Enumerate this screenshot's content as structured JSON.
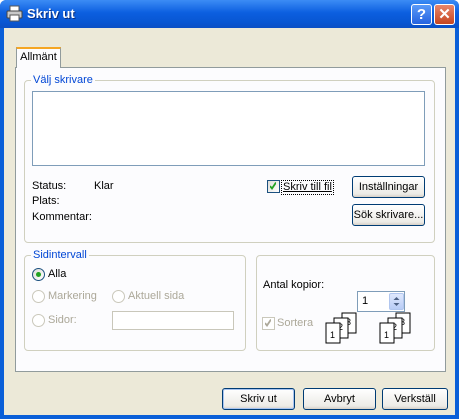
{
  "window": {
    "title": "Skriv ut",
    "help_label": "?",
    "close_label": "✕"
  },
  "tabs": [
    {
      "label": "Allmänt"
    }
  ],
  "printer_group": {
    "label": "Välj skrivare",
    "status_label": "Status:",
    "status_value": "Klar",
    "location_label": "Plats:",
    "comment_label": "Kommentar:",
    "print_to_file_label": "Skriv till fil",
    "print_to_file_checked": true,
    "preferences_button": "Inställningar",
    "find_printer_button": "Sök skrivare..."
  },
  "page_range": {
    "label": "Sidintervall",
    "all_label": "Alla",
    "selection_label": "Markering",
    "current_page_label": "Aktuell sida",
    "pages_label": "Sidor:",
    "pages_value": "",
    "selected": "all"
  },
  "copies": {
    "label": "Antal kopior:",
    "value": "1",
    "collate_label": "Sortera",
    "collate_checked": true
  },
  "footer": {
    "print_button": "Skriv ut",
    "cancel_button": "Avbryt",
    "apply_button": "Verkställ"
  }
}
